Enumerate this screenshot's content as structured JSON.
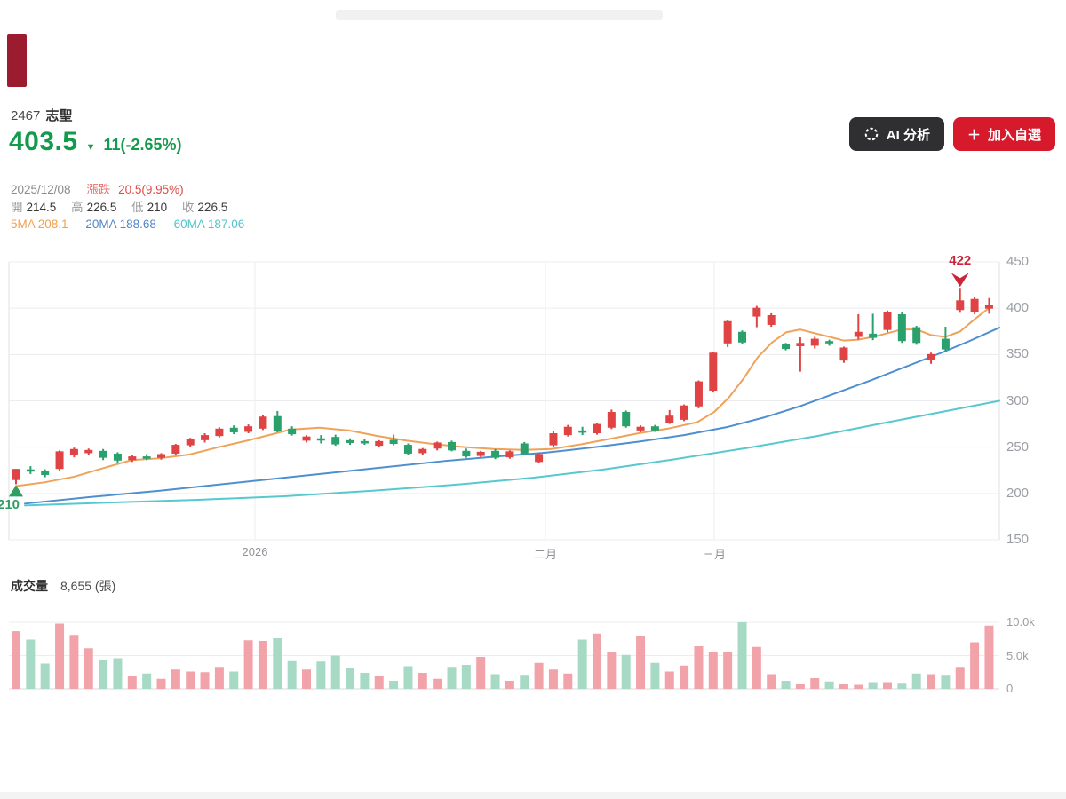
{
  "header": {
    "code": "2467",
    "name": "志聖",
    "last_price": "403.5",
    "down_arrow": "▼",
    "change": "11(-2.65%)",
    "ai_button_label": "AI 分析",
    "add_button_plus": "＋",
    "add_button_label": "加入自選"
  },
  "info": {
    "date": "2025/12/08",
    "change_label": "漲跌",
    "change_value": "20.5(9.95%)",
    "open_label": "開",
    "open_value": "214.5",
    "high_label": "高",
    "high_value": "226.5",
    "low_label": "低",
    "low_value": "210",
    "close_label": "收",
    "close_value": "226.5",
    "ma5_legend": "5MA 208.1",
    "ma20_legend": "20MA 188.68",
    "ma60_legend": "60MA 187.06"
  },
  "volume_header": {
    "label": "成交量",
    "value": "8,655 (張)"
  },
  "colors": {
    "price_green": "#149a4d",
    "candle_up": "#e04343",
    "candle_down": "#2aa16c",
    "vol_up": "#f2a3a9",
    "vol_down": "#a6dac4",
    "ma5": "#f0a259",
    "ma20": "#4e8fd0",
    "ma60": "#56c8ce",
    "grid": "#ededf1",
    "border": "#e2e2e6",
    "ann_red": "#c9263b",
    "ann_green": "#2f9e63",
    "ai_button_bg": "#2f2f31",
    "add_button_bg": "#d7192c"
  },
  "chart_data": [
    {
      "type": "candlestick",
      "title": "2467 志聖 日K",
      "ylim": [
        150,
        450
      ],
      "y_ticks": [
        450,
        400,
        350,
        300,
        250,
        200,
        150
      ],
      "x_ticks": [
        {
          "label": "2026",
          "x": 287
        },
        {
          "label": "二月",
          "x": 614
        },
        {
          "label": "三月",
          "x": 804
        }
      ],
      "candles": [
        [
          214.5,
          226.5,
          210,
          226.5
        ],
        [
          226,
          229.5,
          221,
          224.5
        ],
        [
          224,
          226,
          217.5,
          220
        ],
        [
          226.5,
          246.5,
          224,
          245.5
        ],
        [
          242,
          249.5,
          239,
          248
        ],
        [
          243.5,
          248.5,
          241,
          247
        ],
        [
          246,
          248,
          236,
          238.5
        ],
        [
          243,
          244.5,
          233,
          235.5
        ],
        [
          236,
          241.5,
          234,
          240
        ],
        [
          240,
          242.5,
          236,
          237.5
        ],
        [
          238.5,
          243.5,
          236.5,
          242.5
        ],
        [
          243,
          253.5,
          241.5,
          252.5
        ],
        [
          252,
          260,
          250,
          258.5
        ],
        [
          257.5,
          265,
          255,
          263
        ],
        [
          262,
          271.5,
          260.5,
          270
        ],
        [
          271,
          273.5,
          264,
          266
        ],
        [
          266.5,
          274.5,
          265,
          272.5
        ],
        [
          270,
          284.5,
          268.5,
          283
        ],
        [
          283.5,
          289,
          266,
          267
        ],
        [
          270,
          272.5,
          262.5,
          264
        ],
        [
          257,
          263,
          255,
          261.5
        ],
        [
          259.5,
          263,
          254,
          257.5
        ],
        [
          261,
          263.5,
          251.5,
          253
        ],
        [
          257.5,
          259.5,
          252.5,
          254.5
        ],
        [
          256.5,
          258.5,
          252.5,
          254
        ],
        [
          251.5,
          257.5,
          250,
          256.5
        ],
        [
          258,
          263.5,
          252,
          253.5
        ],
        [
          252.5,
          254,
          241.5,
          243
        ],
        [
          243.5,
          249,
          242,
          248
        ],
        [
          248.5,
          256,
          246.5,
          255
        ],
        [
          255.5,
          257,
          245.5,
          246.5
        ],
        [
          246,
          248.5,
          238.5,
          240
        ],
        [
          240.5,
          246,
          239,
          245
        ],
        [
          246,
          248,
          237,
          238.5
        ],
        [
          239,
          246.5,
          237.5,
          245.5
        ],
        [
          254,
          255.5,
          241,
          242.5
        ],
        [
          234,
          243.5,
          232.5,
          242.5
        ],
        [
          252,
          267,
          250.5,
          265
        ],
        [
          263,
          274,
          261.5,
          272
        ],
        [
          268,
          272,
          263,
          266.5
        ],
        [
          265,
          276.5,
          263.5,
          275
        ],
        [
          271,
          290.5,
          269.5,
          288
        ],
        [
          288,
          289.5,
          271,
          272.5
        ],
        [
          268,
          273.5,
          266,
          272
        ],
        [
          272.5,
          274,
          266.5,
          268
        ],
        [
          276.5,
          290,
          275,
          284
        ],
        [
          279.5,
          296,
          278,
          295
        ],
        [
          294,
          322,
          292,
          321
        ],
        [
          311,
          352.5,
          309,
          352
        ],
        [
          362,
          387,
          358,
          386
        ],
        [
          374.5,
          376,
          361,
          363
        ],
        [
          391,
          402.5,
          379.5,
          400.5
        ],
        [
          382,
          394.5,
          380,
          392.5
        ],
        [
          361,
          362.5,
          354.5,
          356
        ],
        [
          359,
          368.5,
          331.5,
          362.5
        ],
        [
          359.5,
          369,
          356.5,
          367
        ],
        [
          364.5,
          366,
          359.5,
          362
        ],
        [
          343.5,
          358.5,
          341,
          357.5
        ],
        [
          369,
          393.5,
          366,
          374.5
        ],
        [
          372.5,
          394,
          365.5,
          368
        ],
        [
          376.5,
          397.5,
          374,
          395.5
        ],
        [
          393.5,
          395.5,
          362.5,
          364.5
        ],
        [
          379.5,
          381,
          360.5,
          362.5
        ],
        [
          344.5,
          352,
          340,
          350.5
        ],
        [
          367,
          380,
          352.5,
          355.5
        ],
        [
          398,
          422,
          395,
          408.5
        ],
        [
          396,
          412,
          393.5,
          410
        ],
        [
          399.5,
          411,
          394,
          403.5
        ]
      ],
      "series": [
        {
          "name": "5MA",
          "color_key": "ma5",
          "points": [
            [
              18,
              208
            ],
            [
              50,
              212
            ],
            [
              83,
              218
            ],
            [
              115,
              227
            ],
            [
              148,
              236
            ],
            [
              180,
              238
            ],
            [
              213,
              242
            ],
            [
              246,
              250
            ],
            [
              278,
              257
            ],
            [
              311,
              265
            ],
            [
              327,
              269
            ],
            [
              360,
              271
            ],
            [
              393,
              268
            ],
            [
              425,
              262
            ],
            [
              458,
              257
            ],
            [
              491,
              253
            ],
            [
              523,
              250
            ],
            [
              556,
              248
            ],
            [
              589,
              247
            ],
            [
              621,
              248
            ],
            [
              654,
              253
            ],
            [
              687,
              259
            ],
            [
              719,
              265
            ],
            [
              752,
              270
            ],
            [
              785,
              277
            ],
            [
              804,
              288
            ],
            [
              820,
              303
            ],
            [
              837,
              324
            ],
            [
              853,
              347
            ],
            [
              869,
              363
            ],
            [
              885,
              374
            ],
            [
              901,
              377
            ],
            [
              917,
              373
            ],
            [
              934,
              369
            ],
            [
              950,
              365
            ],
            [
              966,
              366
            ],
            [
              983,
              369
            ],
            [
              999,
              373
            ],
            [
              1015,
              377
            ],
            [
              1032,
              377
            ],
            [
              1048,
              371
            ],
            [
              1064,
              369
            ],
            [
              1081,
              375
            ],
            [
              1097,
              388
            ],
            [
              1113,
              400
            ]
          ]
        },
        {
          "name": "20MA",
          "color_key": "ma20",
          "points": [
            [
              28,
              189
            ],
            [
              100,
              196
            ],
            [
              180,
              203
            ],
            [
              260,
              211
            ],
            [
              340,
              219
            ],
            [
              420,
              227
            ],
            [
              500,
              235
            ],
            [
              560,
              240
            ],
            [
              614,
              244
            ],
            [
              670,
              250
            ],
            [
              720,
              256
            ],
            [
              770,
              263
            ],
            [
              820,
              272
            ],
            [
              860,
              282
            ],
            [
              900,
              294
            ],
            [
              940,
              308
            ],
            [
              980,
              322
            ],
            [
              1020,
              337
            ],
            [
              1060,
              352
            ],
            [
              1090,
              364
            ],
            [
              1125,
              379
            ]
          ]
        },
        {
          "name": "60MA",
          "color_key": "ma60",
          "points": [
            [
              28,
              187
            ],
            [
              120,
              190
            ],
            [
              220,
              193
            ],
            [
              320,
              197
            ],
            [
              420,
              203
            ],
            [
              520,
              210
            ],
            [
              600,
              217
            ],
            [
              680,
              226
            ],
            [
              760,
              237
            ],
            [
              840,
              249
            ],
            [
              920,
              262
            ],
            [
              1000,
              277
            ],
            [
              1060,
              288
            ],
            [
              1125,
              300
            ]
          ]
        }
      ],
      "annotations": {
        "high": {
          "text": "422",
          "candle_index": 65,
          "price": 422
        },
        "low": {
          "text": "210",
          "candle_index": 0,
          "price": 210
        }
      }
    },
    {
      "type": "bar",
      "name": "成交量",
      "unit": "張",
      "ymax_k": 10,
      "y_ticks": [
        {
          "label": "10.0k",
          "v": 10
        },
        {
          "label": "5.0k",
          "v": 5
        },
        {
          "label": "0",
          "v": 0
        }
      ],
      "values_k": [
        8.655,
        7.4,
        3.8,
        9.8,
        8.1,
        6.1,
        4.4,
        4.6,
        1.9,
        2.3,
        1.5,
        2.9,
        2.6,
        2.5,
        3.3,
        2.6,
        7.3,
        7.2,
        7.6,
        4.3,
        2.9,
        4.1,
        5.0,
        3.1,
        2.4,
        2.0,
        1.2,
        3.4,
        2.4,
        1.5,
        3.3,
        3.6,
        4.8,
        2.2,
        1.2,
        2.1,
        3.9,
        2.9,
        2.3,
        7.4,
        8.3,
        5.6,
        5.1,
        8.0,
        3.9,
        2.6,
        3.5,
        6.4,
        5.6,
        5.6,
        10.0,
        6.3,
        2.2,
        1.2,
        0.8,
        1.6,
        1.1,
        0.7,
        0.6,
        1.0,
        1.0,
        0.9,
        2.3,
        2.2,
        2.1,
        3.3,
        7.0,
        9.5
      ]
    }
  ]
}
